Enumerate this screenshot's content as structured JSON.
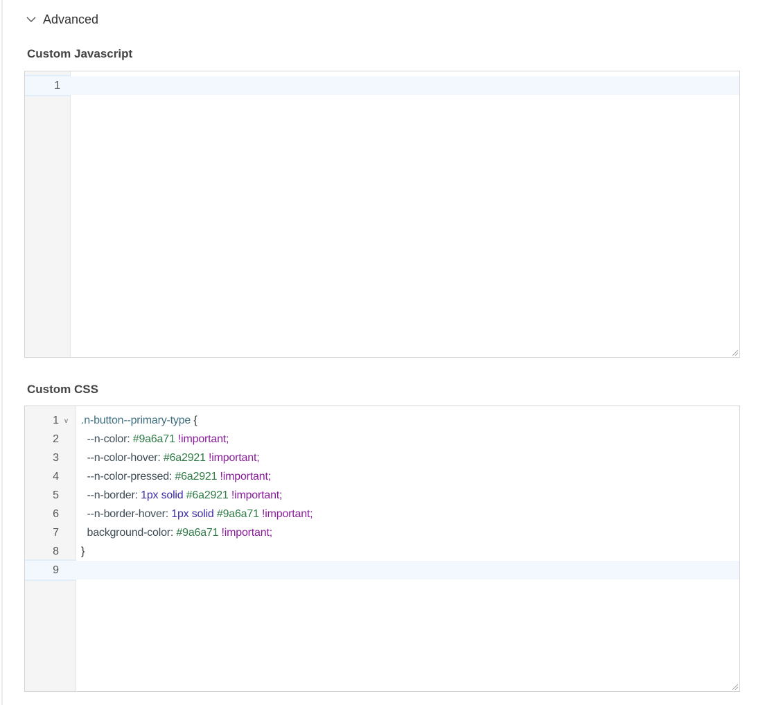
{
  "section": {
    "title": "Advanced",
    "icon": "chevron-down-icon"
  },
  "js_editor": {
    "label": "Custom Javascript",
    "lines": [
      []
    ]
  },
  "css_editor": {
    "label": "Custom CSS",
    "lines": [
      [
        {
          "t": ".n-button--primary-type ",
          "c": "sel"
        },
        {
          "t": "{",
          "c": "punc"
        }
      ],
      [
        {
          "t": "  --n-color: ",
          "c": "prop"
        },
        {
          "t": "#9a6a71",
          "c": "val"
        },
        {
          "t": " !important",
          "c": "imp"
        },
        {
          "t": ";",
          "c": "imp"
        }
      ],
      [
        {
          "t": "  --n-color-hover: ",
          "c": "prop"
        },
        {
          "t": "#6a2921",
          "c": "val"
        },
        {
          "t": " !important",
          "c": "imp"
        },
        {
          "t": ";",
          "c": "imp"
        }
      ],
      [
        {
          "t": "  --n-color-pressed: ",
          "c": "prop"
        },
        {
          "t": "#6a2921",
          "c": "val"
        },
        {
          "t": " !important",
          "c": "imp"
        },
        {
          "t": ";",
          "c": "imp"
        }
      ],
      [
        {
          "t": "  --n-border: ",
          "c": "prop"
        },
        {
          "t": "1px solid ",
          "c": "kw"
        },
        {
          "t": "#6a2921",
          "c": "val"
        },
        {
          "t": " !important",
          "c": "imp"
        },
        {
          "t": ";",
          "c": "imp"
        }
      ],
      [
        {
          "t": "  --n-border-hover: ",
          "c": "prop"
        },
        {
          "t": "1px solid ",
          "c": "kw"
        },
        {
          "t": "#9a6a71",
          "c": "val"
        },
        {
          "t": " !important",
          "c": "imp"
        },
        {
          "t": ";",
          "c": "imp"
        }
      ],
      [
        {
          "t": "  background-color: ",
          "c": "prop"
        },
        {
          "t": "#9a6a71",
          "c": "val"
        },
        {
          "t": " !important",
          "c": "imp"
        },
        {
          "t": ";",
          "c": "imp"
        }
      ],
      [
        {
          "t": "}",
          "c": "punc"
        }
      ],
      []
    ]
  }
}
